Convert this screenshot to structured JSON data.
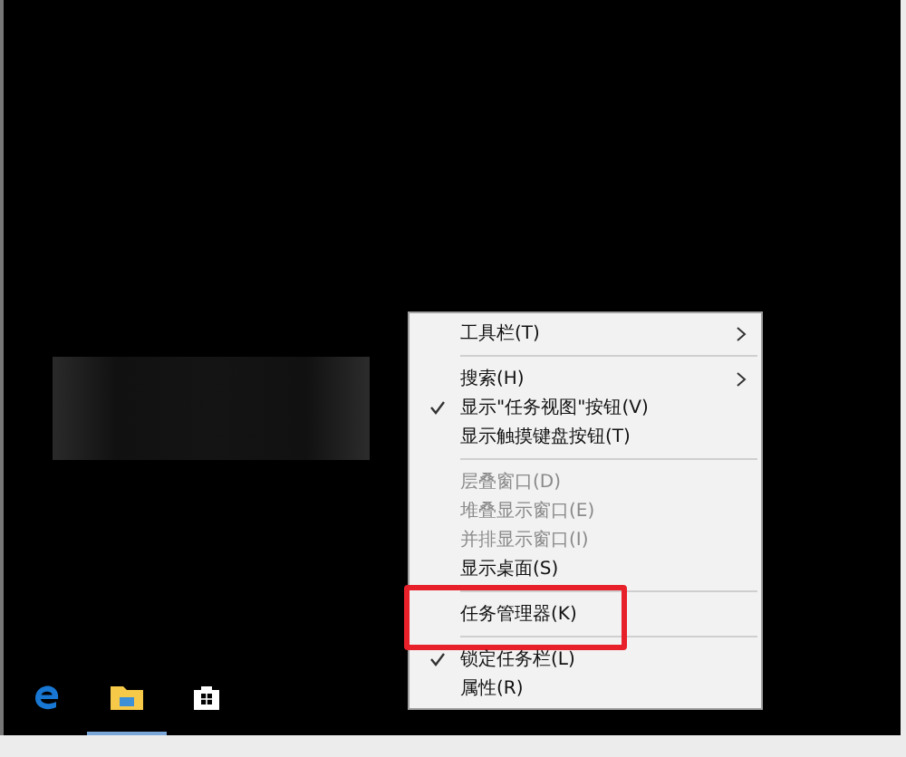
{
  "taskbar": {
    "apps": [
      {
        "kind": "browser",
        "active": false
      },
      {
        "kind": "folder",
        "active": true
      },
      {
        "kind": "store",
        "active": false
      }
    ]
  },
  "context_menu": {
    "items": [
      {
        "kind": "item",
        "label": "工具栏(T)",
        "submenu": true,
        "checked": false,
        "disabled": false,
        "annotated": false
      },
      {
        "kind": "separator"
      },
      {
        "kind": "item",
        "label": "搜索(H)",
        "submenu": true,
        "checked": false,
        "disabled": false,
        "annotated": false
      },
      {
        "kind": "item",
        "label": "显示\"任务视图\"按钮(V)",
        "submenu": false,
        "checked": true,
        "disabled": false,
        "annotated": false
      },
      {
        "kind": "item",
        "label": "显示触摸键盘按钮(T)",
        "submenu": false,
        "checked": false,
        "disabled": false,
        "annotated": false
      },
      {
        "kind": "separator"
      },
      {
        "kind": "item",
        "label": "层叠窗口(D)",
        "submenu": false,
        "checked": false,
        "disabled": true,
        "annotated": false
      },
      {
        "kind": "item",
        "label": "堆叠显示窗口(E)",
        "submenu": false,
        "checked": false,
        "disabled": true,
        "annotated": false
      },
      {
        "kind": "item",
        "label": "并排显示窗口(I)",
        "submenu": false,
        "checked": false,
        "disabled": true,
        "annotated": false
      },
      {
        "kind": "item",
        "label": "显示桌面(S)",
        "submenu": false,
        "checked": false,
        "disabled": false,
        "annotated": false
      },
      {
        "kind": "separator"
      },
      {
        "kind": "item",
        "label": "任务管理器(K)",
        "submenu": false,
        "checked": false,
        "disabled": false,
        "annotated": true
      },
      {
        "kind": "separator"
      },
      {
        "kind": "item",
        "label": "锁定任务栏(L)",
        "submenu": false,
        "checked": true,
        "disabled": false,
        "annotated": false
      },
      {
        "kind": "item",
        "label": "属性(R)",
        "submenu": false,
        "checked": false,
        "disabled": false,
        "annotated": false
      }
    ]
  }
}
